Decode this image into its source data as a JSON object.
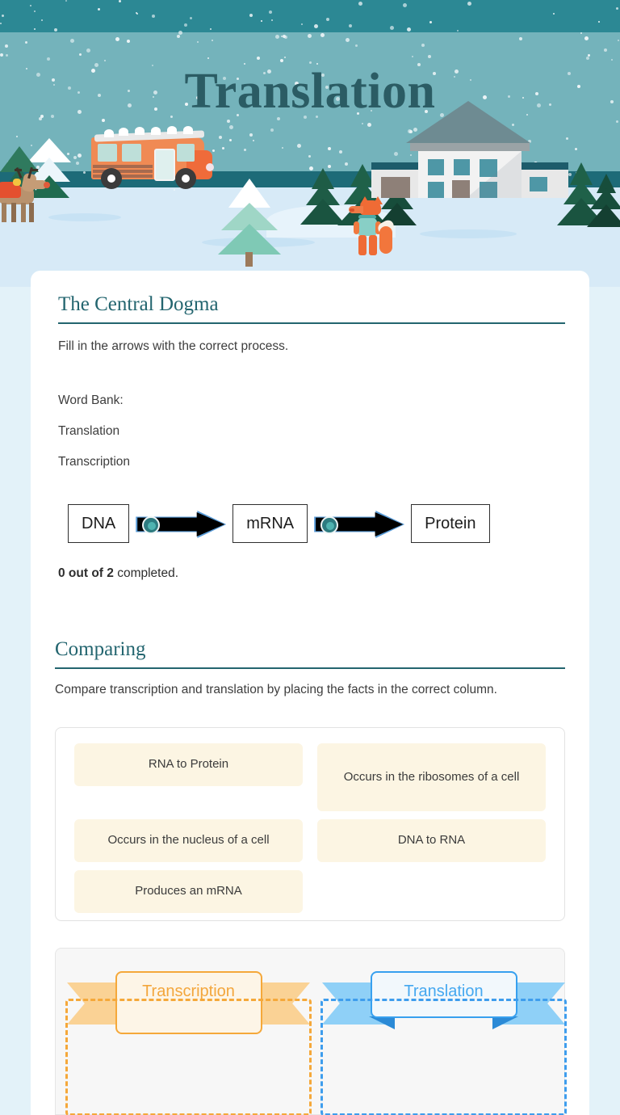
{
  "hero": {
    "title": "Translation"
  },
  "section1": {
    "heading": "The Central Dogma",
    "instructions": "Fill in the arrows with the correct process.",
    "word_bank_label": "Word Bank:",
    "word_bank": [
      "Translation",
      "Transcription"
    ],
    "diagram": {
      "terms": [
        "DNA",
        "mRNA",
        "Protein"
      ],
      "arrows": [
        "blank-drop-target",
        "blank-drop-target"
      ]
    },
    "progress_count": "0 out of 2",
    "progress_suffix": " completed."
  },
  "section2": {
    "heading": "Comparing",
    "instructions": "Compare transcription and translation by placing the facts in the correct column.",
    "facts": [
      "RNA to Protein",
      "Occurs in the ribosomes of a cell",
      "Occurs in the nucleus of a cell",
      "DNA to RNA",
      "Produces an mRNA"
    ],
    "columns": [
      {
        "label": "Transcription",
        "color": "#f3a63c"
      },
      {
        "label": "Translation",
        "color": "#45a8f0"
      }
    ]
  },
  "colors": {
    "page_background": "#e3f2f9",
    "sky_top": "#2c8894",
    "sky_main": "#74b3bb",
    "horizon": "#1d6b78",
    "snow": "#d7eaf7",
    "heading_teal": "#23656f",
    "tile_cream": "#fcf5e3",
    "accent_orange": "#f5a83a",
    "accent_blue": "#3e9ded"
  }
}
